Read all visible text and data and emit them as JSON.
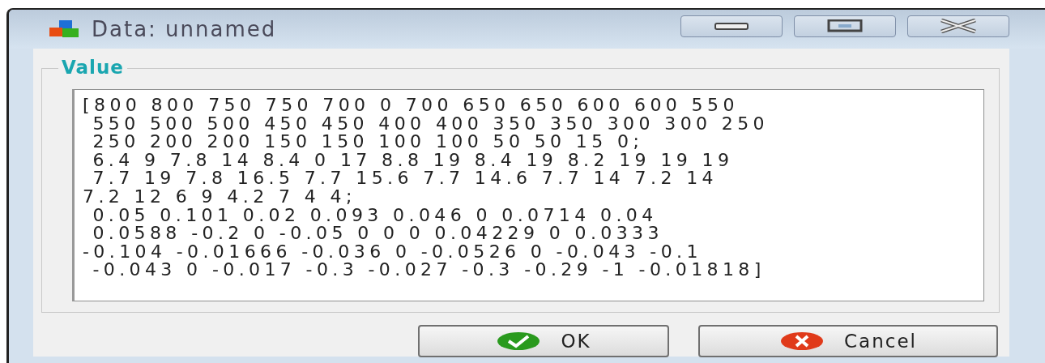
{
  "window": {
    "title": "Data: unnamed"
  },
  "title_buttons": [
    {
      "kind": "minimize"
    },
    {
      "kind": "maximize"
    },
    {
      "kind": "close"
    }
  ],
  "group": {
    "label": "Value",
    "value": "[800 800 750 750 700 0 700 650 650 600 600 550\n 550 500 500 450 450 400 400 350 350 300 300 250\n 250 200 200 150 150 100 100 50 50 15 0;\n 6.4 9 7.8 14 8.4 0 17 8.8 19 8.4 19 8.2 19 19 19\n 7.7 19 7.8 16.5 7.7 15.6 7.7 14.6 7.7 14 7.2 14\n7.2 12 6 9 4.2 7 4 4;\n 0.05 0.101 0.02 0.093 0.046 0 0.0714 0.04\n 0.0588 -0.2 0 -0.05 0 0 0 0.04229 0 0.0333\n-0.104 -0.01666 -0.036 0 -0.0526 0 -0.043 -0.1\n -0.043 0 -0.017 -0.3 -0.027 -0.3 -0.29 -1 -0.01818]"
  },
  "buttons": [
    {
      "label": "OK",
      "kind": "ok"
    },
    {
      "label": "Cancel",
      "kind": "cancel"
    }
  ]
}
